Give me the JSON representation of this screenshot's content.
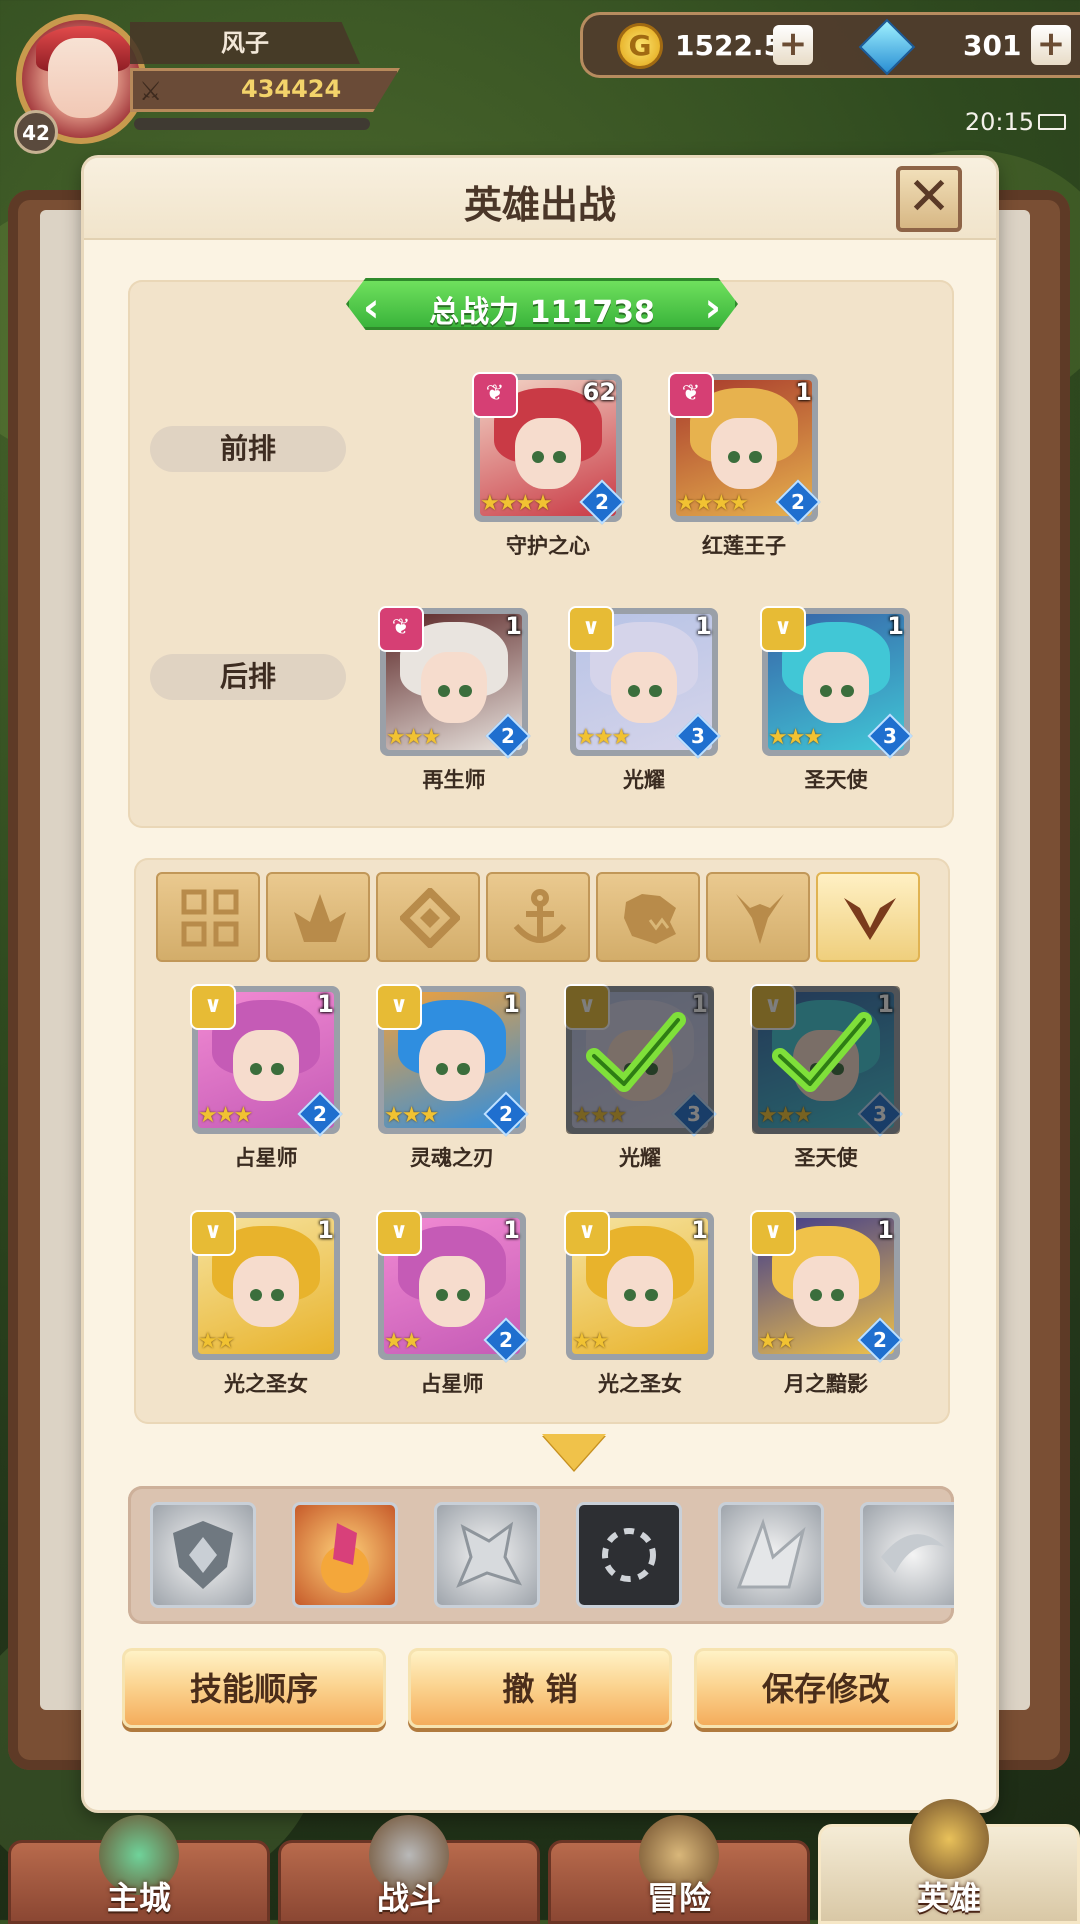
{
  "player": {
    "name": "风子",
    "level": "42",
    "power": "434424",
    "xp_fraction": 0.0
  },
  "resources": {
    "gold": "1522.5K",
    "gems": "301",
    "gold_icon_glyph": "G"
  },
  "status": {
    "time": "20:15"
  },
  "modal": {
    "title": "英雄出战",
    "close_glyph": "✕",
    "total_power": "总战力    111738"
  },
  "lineup": {
    "front_label": "前排",
    "back_label": "后排",
    "front": [
      {
        "name": "守护之心",
        "level": "62",
        "stars": "★★★★",
        "rank": "2",
        "tag": "pink",
        "palette": [
          "#c93a45",
          "#f2d4c6"
        ]
      },
      {
        "name": "红莲王子",
        "level": "1",
        "stars": "★★★★",
        "rank": "2",
        "tag": "pink",
        "palette": [
          "#e7b24e",
          "#a83a2c"
        ]
      }
    ],
    "back": [
      {
        "name": "再生师",
        "level": "1",
        "stars": "★★★",
        "rank": "2",
        "tag": "pink",
        "palette": [
          "#e9e4df",
          "#5a2525"
        ]
      },
      {
        "name": "光耀",
        "level": "1",
        "stars": "★★★",
        "rank": "3",
        "tag": "gold",
        "palette": [
          "#d5d4ea",
          "#b7c3e6"
        ]
      },
      {
        "name": "圣天使",
        "level": "1",
        "stars": "★★★",
        "rank": "3",
        "tag": "gold",
        "palette": [
          "#41c7d6",
          "#3764a8"
        ]
      }
    ]
  },
  "filters": [
    {
      "icon": "grid-icon",
      "active": false
    },
    {
      "icon": "leaf-faction-icon",
      "active": false
    },
    {
      "icon": "diamond-faction-icon",
      "active": false
    },
    {
      "icon": "anchor-faction-icon",
      "active": false
    },
    {
      "icon": "beast-faction-icon",
      "active": false
    },
    {
      "icon": "horn-faction-icon",
      "active": false
    },
    {
      "icon": "light-faction-icon",
      "active": true
    }
  ],
  "roster": [
    {
      "name": "占星师",
      "level": "1",
      "stars": "★★★",
      "rank": "2",
      "selected": false,
      "palette": [
        "#c55bb6",
        "#f28bd3"
      ]
    },
    {
      "name": "灵魂之刃",
      "level": "1",
      "stars": "★★★",
      "rank": "2",
      "selected": false,
      "palette": [
        "#2f8ee0",
        "#f2a13a"
      ]
    },
    {
      "name": "光耀",
      "level": "1",
      "stars": "★★★",
      "rank": "3",
      "selected": true,
      "palette": [
        "#d5d4ea",
        "#b7c3e6"
      ]
    },
    {
      "name": "圣天使",
      "level": "1",
      "stars": "★★★",
      "rank": "3",
      "selected": true,
      "palette": [
        "#41c7d6",
        "#3764a8"
      ]
    },
    {
      "name": "光之圣女",
      "level": "1",
      "stars": "★★",
      "rank": "",
      "selected": false,
      "palette": [
        "#e8b32c",
        "#f6e3a0"
      ]
    },
    {
      "name": "占星师",
      "level": "1",
      "stars": "★★",
      "rank": "2",
      "selected": false,
      "palette": [
        "#c55bb6",
        "#f28bd3"
      ]
    },
    {
      "name": "光之圣女",
      "level": "1",
      "stars": "★★",
      "rank": "",
      "selected": false,
      "palette": [
        "#e8b32c",
        "#f6e3a0"
      ]
    },
    {
      "name": "月之黯影",
      "level": "1",
      "stars": "★★",
      "rank": "2",
      "selected": false,
      "palette": [
        "#f0c24a",
        "#3e3a8c"
      ]
    }
  ],
  "skills": [
    {
      "icon": "shield-skill-icon"
    },
    {
      "icon": "crystal-skill-icon"
    },
    {
      "icon": "ice-skill-icon"
    },
    {
      "icon": "vortex-skill-icon"
    },
    {
      "icon": "shard-skill-icon"
    },
    {
      "icon": "wind-skill-icon"
    }
  ],
  "actions": {
    "skill_order": "技能顺序",
    "undo": "撤 销",
    "save": "保存修改"
  },
  "nav": [
    {
      "label": "主城",
      "active": false
    },
    {
      "label": "战斗",
      "active": false
    },
    {
      "label": "冒险",
      "active": false
    },
    {
      "label": "英雄",
      "active": true
    }
  ]
}
